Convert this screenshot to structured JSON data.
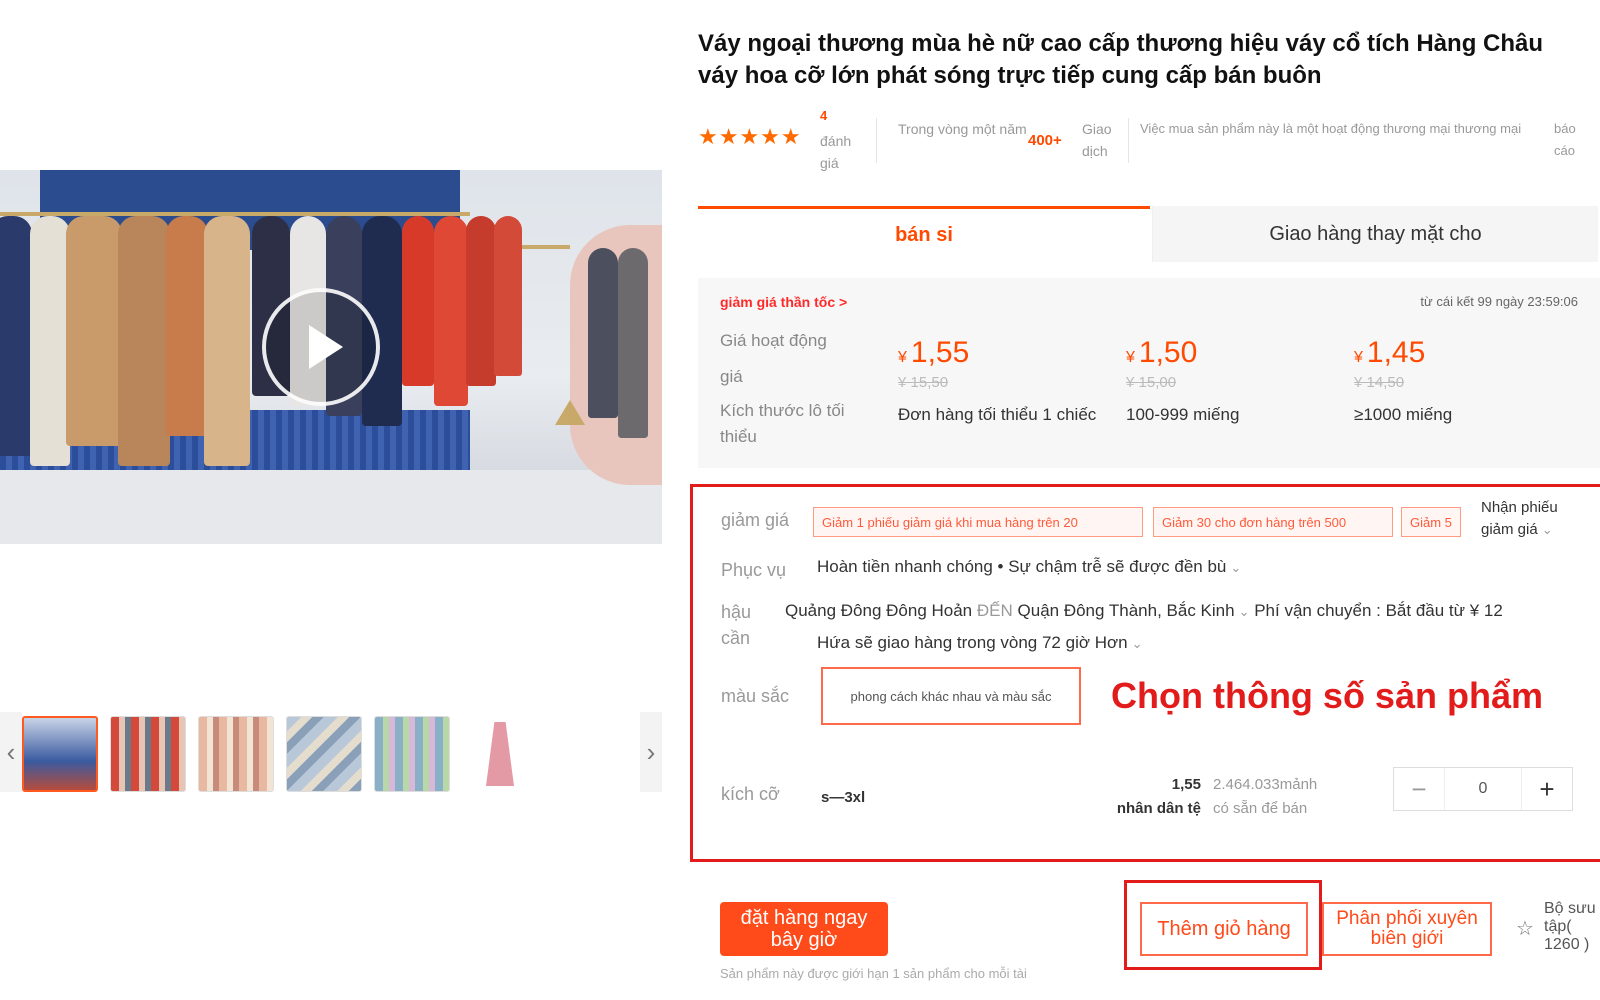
{
  "product": {
    "title": "Váy ngoại thương mùa hè nữ cao cấp thương hiệu váy cổ tích Hàng Châu váy hoa cỡ lớn phát sóng trực tiếp cung cấp bán buôn"
  },
  "rating": {
    "stars": "★★★★★",
    "reviews_count": "4",
    "reviews_label": "đánh giá",
    "within_label": "Trong vòng một năm",
    "transactions_count": "400+",
    "transactions_label": "Giao dịch",
    "commercial_note": "Việc mua sản phẩm này là một hoạt động thương mại thương mại",
    "report_label": "báo cáo"
  },
  "tabs": [
    {
      "label": "bán si",
      "active": true
    },
    {
      "label": "Giao hàng thay mặt cho",
      "active": false
    }
  ],
  "pricing": {
    "flash_sale": "giảm giá thần tốc >",
    "countdown": "từ cái kết 99 ngày 23:59:06",
    "label_activity_price_1": "Giá hoạt động",
    "label_activity_price_2": "giá",
    "label_batch_1": "Kích thước lô tối",
    "label_batch_2": "thiểu",
    "currency": "¥",
    "tiers": [
      {
        "price": "1,55",
        "original": "¥ 15,50",
        "min_qty": "Đơn hàng tối thiểu 1 chiếc"
      },
      {
        "price": "1,50",
        "original": "¥ 15,00",
        "min_qty": "100-999 miếng"
      },
      {
        "price": "1,45",
        "original": "¥ 14,50",
        "min_qty": "≥1000 miếng"
      }
    ]
  },
  "specs": {
    "discount_label": "giảm giá",
    "coupons": [
      "Giảm 1 phiếu giảm giá khi mua hàng trên 20",
      "Giảm 30 cho đơn hàng trên 500",
      "Giảm 5"
    ],
    "get_coupon": "Nhận phiếu giảm giá",
    "service_label": "Phục vụ",
    "service_text": "Hoàn tiền nhanh chóng • Sự chậm trễ sẽ được đền bù",
    "logistics_label_1": "hậu",
    "logistics_label_2": "cần",
    "from_location": "Quảng Đông Đông Hoản",
    "to_word": "ĐẾN",
    "to_location": "Quận Đông Thành, Bắc Kinh",
    "shipping_fee": "Phí vận chuyển : Bắt đầu từ ¥ 12",
    "delivery_promise": "Hứa sẽ giao hàng trong vòng 72 giờ",
    "delivery_more": "Hơn",
    "color_label": "màu sắc",
    "color_option": "phong cách khác nhau và màu sắc",
    "annotation": "Chọn thông số sản phẩm",
    "size_label": "kích cỡ",
    "size_value": "s—3xl",
    "size_price_1": "1,55",
    "size_price_2": "nhân dân tệ",
    "stock_1": "2.464.033mảnh",
    "stock_2": "có sẵn để bán",
    "qty_minus": "−",
    "qty_value": "0",
    "qty_plus": "+"
  },
  "actions": {
    "order_now_1": "đặt hàng ngay",
    "order_now_2": "bây giờ",
    "order_note": "Sản phẩm này được giới hạn 1 sản phẩm cho mỗi tài",
    "add_to_cart": "Thêm giỏ hàng",
    "distribution_1": "Phân phối xuyên",
    "distribution_2": "biên giới",
    "collection_1": "Bộ sưu",
    "collection_2": "tập(",
    "collection_3": "1260 )"
  },
  "gallery": {
    "thumb_icons": [
      "video-thumb",
      "dress-rack",
      "dress-rack",
      "dress-pile",
      "dress-rack",
      "pink-dress"
    ]
  },
  "colors": {
    "accent": "#ff4a00",
    "annotation_red": "#e21b1b"
  }
}
